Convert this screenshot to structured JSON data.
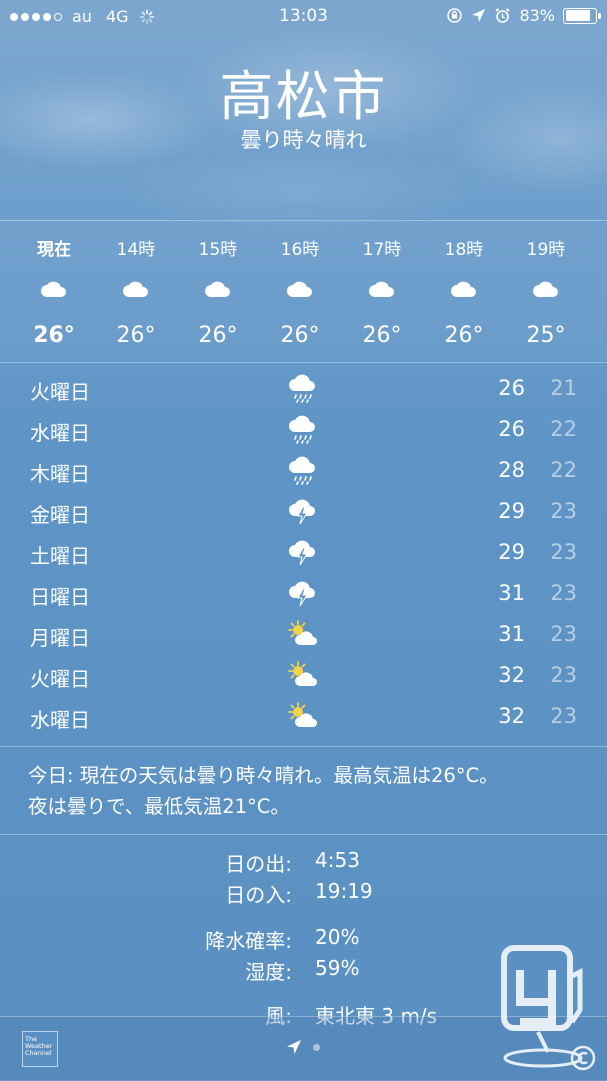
{
  "status_bar": {
    "carrier": "au",
    "network": "4G",
    "time": "13:03",
    "battery": "83%",
    "battery_level": 0.83
  },
  "header": {
    "city": "高松市",
    "condition": "曇り時々晴れ"
  },
  "hourly": [
    {
      "time": "現在",
      "icon": "cloud-icon",
      "temp": "26°"
    },
    {
      "time": "14時",
      "icon": "cloud-icon",
      "temp": "26°"
    },
    {
      "time": "15時",
      "icon": "cloud-icon",
      "temp": "26°"
    },
    {
      "time": "16時",
      "icon": "cloud-icon",
      "temp": "26°"
    },
    {
      "time": "17時",
      "icon": "cloud-icon",
      "temp": "26°"
    },
    {
      "time": "18時",
      "icon": "cloud-icon",
      "temp": "26°"
    },
    {
      "time": "19時",
      "icon": "cloud-icon",
      "temp": "25°"
    }
  ],
  "daily": [
    {
      "day": "火曜日",
      "icon": "rain-cloud-icon",
      "high": "26",
      "low": "21"
    },
    {
      "day": "水曜日",
      "icon": "rain-cloud-icon",
      "high": "26",
      "low": "22"
    },
    {
      "day": "木曜日",
      "icon": "rain-cloud-icon",
      "high": "28",
      "low": "22"
    },
    {
      "day": "金曜日",
      "icon": "thunder-cloud-icon",
      "high": "29",
      "low": "23"
    },
    {
      "day": "土曜日",
      "icon": "thunder-cloud-icon",
      "high": "29",
      "low": "23"
    },
    {
      "day": "日曜日",
      "icon": "thunder-cloud-icon",
      "high": "31",
      "low": "23"
    },
    {
      "day": "月曜日",
      "icon": "partly-sunny-icon",
      "high": "31",
      "low": "23"
    },
    {
      "day": "火曜日",
      "icon": "partly-sunny-icon",
      "high": "32",
      "low": "23"
    },
    {
      "day": "水曜日",
      "icon": "partly-sunny-icon",
      "high": "32",
      "low": "23"
    }
  ],
  "summary": {
    "line1": "今日: 現在の天気は曇り時々晴れ。最高気温は26°C。",
    "line2": "夜は曇りで、最低気温21°C。"
  },
  "details": [
    {
      "label": "日の出:",
      "value": "4:53"
    },
    {
      "label": "日の入:",
      "value": "19:19"
    },
    {
      "label": "降水確率:",
      "value": "20%"
    },
    {
      "label": "湿度:",
      "value": "59%"
    },
    {
      "label": "風:",
      "value": "東北東 3 m/s"
    }
  ],
  "footer": {
    "logo_line1": "The",
    "logo_line2": "Weather",
    "logo_line3": "Channel"
  },
  "colors": {
    "background": "#5f95c6",
    "text": "#ffffff",
    "sun": "#f7d34a"
  }
}
